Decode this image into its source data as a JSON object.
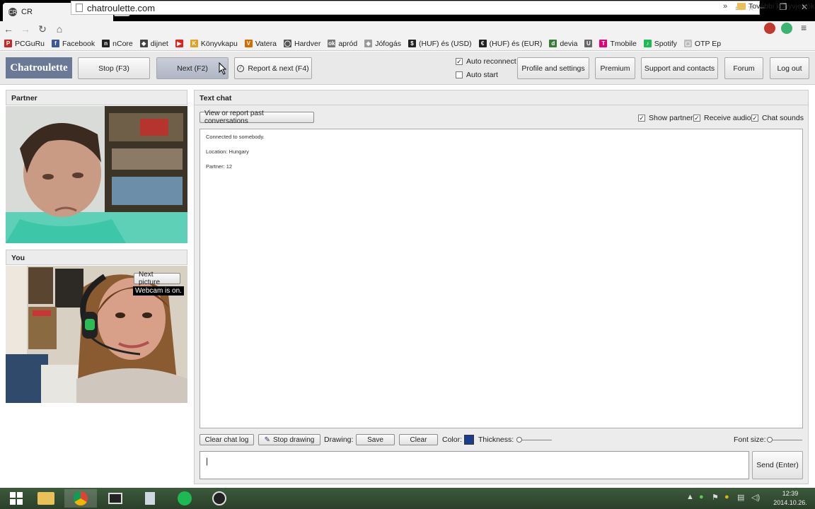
{
  "browser": {
    "tab_title": "CR",
    "url": "chatroulette.com",
    "bookmarks": [
      {
        "label": "PCGuRu",
        "color": "#c62828",
        "glyph": "P"
      },
      {
        "label": "Facebook",
        "color": "#3b5998",
        "glyph": "f"
      },
      {
        "label": "nCore",
        "color": "#222222",
        "glyph": "n"
      },
      {
        "label": "dijnet",
        "color": "#444444",
        "glyph": "◆"
      },
      {
        "label": "",
        "color": "#e62117",
        "glyph": "▶"
      },
      {
        "label": "Könyvkapu",
        "color": "#e0a020",
        "glyph": "K"
      },
      {
        "label": "Vatera",
        "color": "#d46a00",
        "glyph": "V"
      },
      {
        "label": "Hardver",
        "color": "#555555",
        "glyph": "◯"
      },
      {
        "label": "apród",
        "color": "#777777",
        "glyph": "ok"
      },
      {
        "label": "Jófogás",
        "color": "#999999",
        "glyph": "◈"
      },
      {
        "label": "(HUF) és (USD)",
        "color": "#222222",
        "glyph": "$"
      },
      {
        "label": "(HUF) és (EUR)",
        "color": "#222222",
        "glyph": "€"
      },
      {
        "label": "devia",
        "color": "#3b7a3b",
        "glyph": "d"
      },
      {
        "label": "",
        "color": "#666666",
        "glyph": "U"
      },
      {
        "label": "Tmobile",
        "color": "#e20074",
        "glyph": "T"
      },
      {
        "label": "Spotify",
        "color": "#1db954",
        "glyph": "♪"
      },
      {
        "label": "OTP Ep",
        "color": "#bbbbbb",
        "glyph": "▢"
      }
    ],
    "bookmarks_more": "»",
    "bookmarks_folder": "További könyvjelzők"
  },
  "site": {
    "logo": "Chatroulette",
    "stop_label": "Stop (F3)",
    "next_label": "Next (F2)",
    "report_label": "Report & next (F4)",
    "auto_reconnect": {
      "label": "Auto reconnect",
      "checked": true
    },
    "auto_start": {
      "label": "Auto start",
      "checked": false
    },
    "nav": {
      "profile": "Profile and settings",
      "premium": "Premium",
      "support": "Support and contacts",
      "forum": "Forum",
      "logout": "Log out"
    }
  },
  "partner": {
    "header": "Partner"
  },
  "you": {
    "header": "You",
    "next_picture": "Next picture",
    "webcam_status": "Webcam is on."
  },
  "chat": {
    "header": "Text chat",
    "view_report": "View or report past conversations",
    "show_partner": "Show partner",
    "receive_audio": "Receive audio",
    "chat_sounds": "Chat sounds",
    "messages": [
      "Connected to somebody.",
      "Location: Hungary",
      "Partner: 12"
    ],
    "clear_log": "Clear chat log",
    "stop_drawing": "Stop drawing",
    "drawing_label": "Drawing:",
    "save": "Save",
    "clear": "Clear",
    "color_label": "Color:",
    "thickness_label": "Thickness:",
    "font_size_label": "Font size:",
    "input_value": "|",
    "send": "Send (Enter)"
  },
  "taskbar": {
    "time": "12:39",
    "date": "2014.10.26."
  }
}
